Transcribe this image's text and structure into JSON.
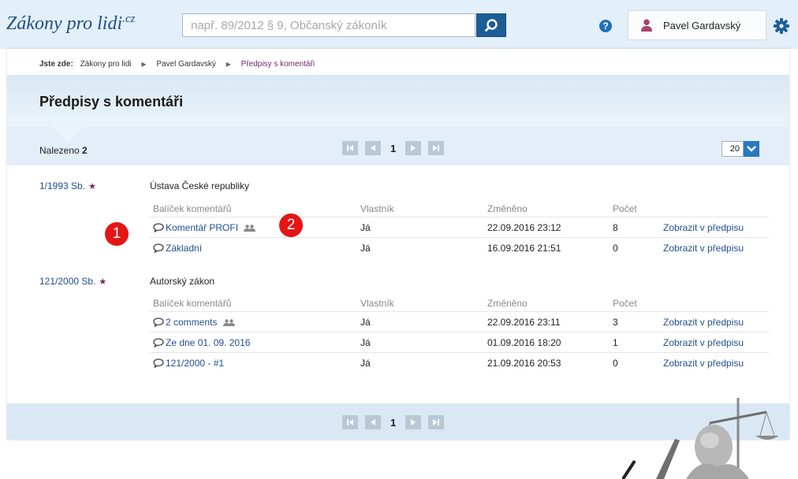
{
  "header": {
    "logo": "Zákony pro lidi",
    "logo_suffix": ".cz",
    "search_placeholder": "např. 89/2012 § 9, Občanský zákoník",
    "user_name": "Pavel Gardavský",
    "help_label": "?"
  },
  "breadcrumb": {
    "label": "Jste zde:",
    "items": [
      "Zákony pro lidi",
      "Pavel Gardavský",
      "Předpisy s komentáři"
    ]
  },
  "page_title": "Předpisy s komentáři",
  "toolbar": {
    "found_label": "Nalezeno",
    "found_count": "2",
    "page_number": "1",
    "per_page": "20"
  },
  "columns": {
    "package": "Balíček komentářů",
    "owner": "Vlastník",
    "changed": "Změněno",
    "count": "Počet"
  },
  "laws": [
    {
      "number": "1/1993 Sb.",
      "name": "Ústava České republiky",
      "rows": [
        {
          "name": "Komentář PROFI",
          "shared": true,
          "owner": "Já",
          "changed": "22.09.2016 23:12",
          "count": "8",
          "link": "Zobrazit v předpisu"
        },
        {
          "name": "Základní",
          "shared": false,
          "owner": "Já",
          "changed": "16.09.2016 21:51",
          "count": "0",
          "link": "Zobrazit v předpisu"
        }
      ]
    },
    {
      "number": "121/2000 Sb.",
      "name": "Autorský zákon",
      "rows": [
        {
          "name": "2 comments",
          "shared": true,
          "owner": "Já",
          "changed": "22.09.2016 23:11",
          "count": "3",
          "link": "Zobrazit v předpisu"
        },
        {
          "name": "Ze dne 01. 09. 2016",
          "shared": false,
          "owner": "Já",
          "changed": "01.09.2016 18:20",
          "count": "1",
          "link": "Zobrazit v předpisu"
        },
        {
          "name": "121/2000 - #1",
          "shared": false,
          "owner": "Já",
          "changed": "21.09.2016 20:53",
          "count": "0",
          "link": "Zobrazit v předpisu"
        }
      ]
    }
  ],
  "callouts": [
    "1",
    "2"
  ],
  "colors": {
    "brand": "#1f4e86",
    "link": "#1f4f8f",
    "callout": "#e51515",
    "star": "#7b2552"
  }
}
